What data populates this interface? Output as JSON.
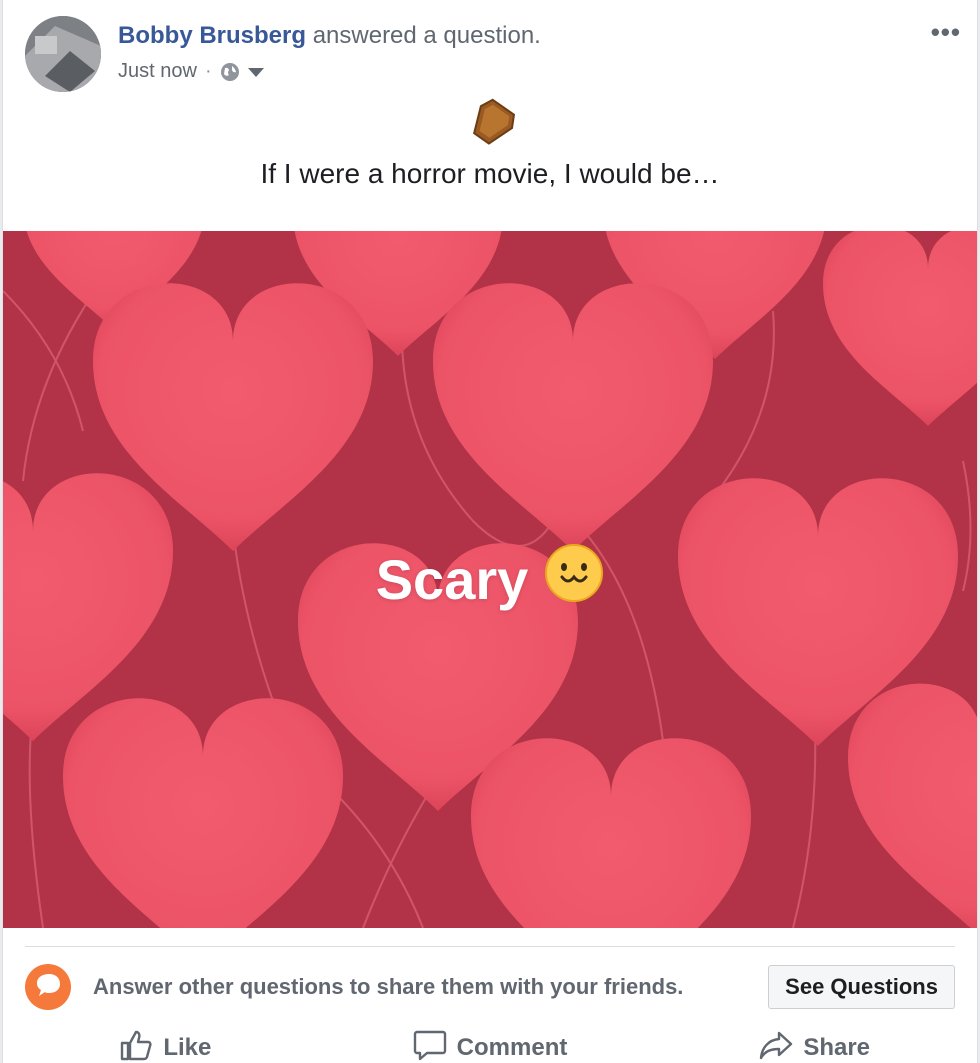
{
  "post": {
    "author": "Bobby Brusberg",
    "action_text": "answered a question.",
    "timestamp": "Just now",
    "separator": "·",
    "privacy_icon": "globe-icon",
    "menu_icon": "more-options-icon",
    "question_icon": "coffin-icon",
    "question": "If I were a horror movie, I would be…",
    "answer": "Scary",
    "answer_emoji_icon": "smiley-cat-face-icon",
    "card_colors": {
      "background": "#b23347",
      "heart": "#ee5669"
    }
  },
  "prompt": {
    "icon": "question-bubble-icon",
    "text": "Answer other questions to share them with your friends.",
    "button_label": "See Questions"
  },
  "actions": {
    "like": "Like",
    "comment": "Comment",
    "share": "Share"
  },
  "colors": {
    "link": "#385898",
    "muted": "#606770",
    "accent_orange": "#f5793a"
  }
}
